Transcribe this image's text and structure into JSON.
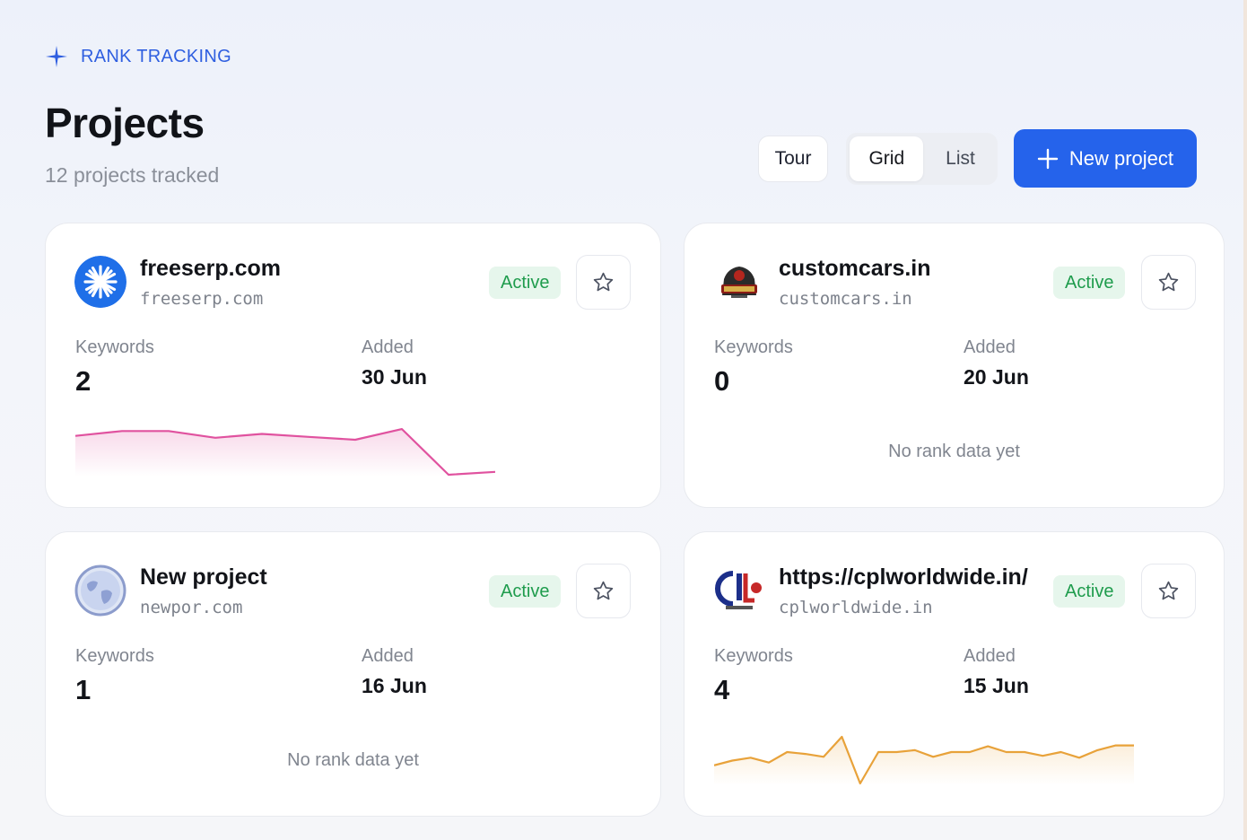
{
  "header": {
    "eyebrow": "RANK TRACKING",
    "title": "Projects",
    "subtitle": "12 projects tracked"
  },
  "toolbar": {
    "tour_label": "Tour",
    "view_options": [
      "Grid",
      "List"
    ],
    "selected_view": "Grid",
    "new_project_label": "New project"
  },
  "colors": {
    "accent": "#2563eb",
    "active_badge_bg": "#e6f6ec",
    "active_badge_text": "#1f9c4d",
    "spark_pink": "#e0529f",
    "spark_orange": "#e8a23a"
  },
  "labels": {
    "keywords": "Keywords",
    "added": "Added",
    "no_data": "No rank data yet"
  },
  "projects": [
    {
      "name": "freeserp.com",
      "domain": "freeserp.com",
      "status": "Active",
      "keywords": "2",
      "added": "30 Jun",
      "logo_icon": "freeserp-logo-icon",
      "has_rank_data": true,
      "trend_color": "#e0529f",
      "trend": [
        8,
        3,
        3,
        10,
        6,
        9,
        12,
        1,
        48,
        45
      ]
    },
    {
      "name": "customcars.in",
      "domain": "customcars.in",
      "status": "Active",
      "keywords": "0",
      "added": "20 Jun",
      "logo_icon": "customcars-logo-icon",
      "has_rank_data": false
    },
    {
      "name": "New project",
      "domain": "newpor.com",
      "status": "Active",
      "keywords": "1",
      "added": "16 Jun",
      "logo_icon": "globe-icon",
      "has_rank_data": false
    },
    {
      "name": "https://cplworldwide.in/",
      "domain": "cplworldwide.in",
      "status": "Active",
      "keywords": "4",
      "added": "15 Jun",
      "logo_icon": "cpl-logo-icon",
      "has_rank_data": true,
      "trend_color": "#e8a23a",
      "trend": [
        30,
        25,
        22,
        27,
        16,
        18,
        21,
        0,
        49,
        16,
        16,
        14,
        21,
        16,
        16,
        10,
        16,
        16,
        20,
        16,
        22,
        14,
        9,
        9
      ]
    }
  ]
}
